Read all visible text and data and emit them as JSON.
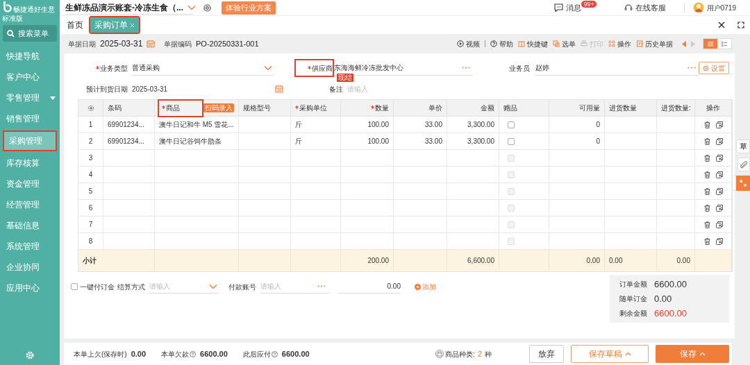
{
  "brand": {
    "name": "畅捷通好生意",
    "edition": "标准版"
  },
  "topbar": {
    "account": "生鲜冻品演示账套-冷冻生食（...",
    "promo_button": "体验行业方案",
    "messages": {
      "label": "消息",
      "badge": "99+"
    },
    "support": "在线客服",
    "user": "用户0719"
  },
  "sidebar": {
    "search": "搜索菜单",
    "items": [
      {
        "label": "快捷导航",
        "selected": false,
        "highlighted": false
      },
      {
        "label": "客户中心",
        "selected": false,
        "highlighted": false
      },
      {
        "label": "零售管理",
        "selected": false,
        "highlighted": false,
        "expanded": false
      },
      {
        "label": "销售管理",
        "selected": false,
        "highlighted": false
      },
      {
        "label": "采购管理",
        "selected": true,
        "highlighted": true
      },
      {
        "label": "库存核算",
        "selected": false,
        "highlighted": false
      },
      {
        "label": "资金管理",
        "selected": false,
        "highlighted": false
      },
      {
        "label": "经营管理",
        "selected": false,
        "highlighted": false
      },
      {
        "label": "基础信息",
        "selected": false,
        "highlighted": false
      },
      {
        "label": "系统管理",
        "selected": false,
        "highlighted": false
      },
      {
        "label": "企业协同",
        "selected": false,
        "highlighted": false
      },
      {
        "label": "应用中心",
        "selected": false,
        "highlighted": false
      }
    ]
  },
  "tabs": [
    {
      "label": "首页",
      "selected": false,
      "closable": false,
      "highlighted": false
    },
    {
      "label": "采购订单",
      "selected": true,
      "closable": true,
      "highlighted": true
    }
  ],
  "toolbar": {
    "date_label": "单据日期",
    "date": "2025-03-31",
    "code_label": "单据编码",
    "code": "PO-20250331-001",
    "actions": [
      {
        "kind": "video",
        "label": "视频",
        "disabled": false
      },
      {
        "kind": "help",
        "label": "帮助",
        "disabled": false
      },
      {
        "kind": "shortcut",
        "label": "快捷键",
        "disabled": false
      },
      {
        "kind": "select",
        "label": "选单",
        "disabled": false
      },
      {
        "kind": "print",
        "label": "打印",
        "disabled": true
      },
      {
        "kind": "operate",
        "label": "操作",
        "disabled": false
      },
      {
        "kind": "history",
        "label": "历史单据",
        "disabled": false
      }
    ],
    "views": [
      {
        "kind": "list",
        "selected": true
      },
      {
        "kind": "detail",
        "selected": false
      }
    ]
  },
  "form": {
    "business_type": {
      "label": "业务类型",
      "required": true,
      "value": "普通采购"
    },
    "supplier": {
      "label": "供应商",
      "required": true,
      "highlighted": true,
      "value": "东海海鲜冷冻批发中心",
      "tag": "现结"
    },
    "salesperson": {
      "label": "业务员",
      "value": "赵婷"
    },
    "settings_button": "设置",
    "arrival_date": {
      "label": "预计到货日期",
      "value": "2025-03-31"
    },
    "remark": {
      "label": "备注",
      "placeholder": "请输入"
    }
  },
  "table": {
    "columns": [
      {
        "label": "条码",
        "required": false
      },
      {
        "label": "商品",
        "required": true,
        "highlighted": true,
        "badge": "扫码录入"
      },
      {
        "label": "规格型号",
        "required": false
      },
      {
        "label": "采购单位",
        "required": true
      },
      {
        "label": "数量",
        "required": true
      },
      {
        "label": "单价",
        "required": false
      },
      {
        "label": "金额",
        "required": false
      },
      {
        "label": "赠品",
        "required": false
      },
      {
        "label": "可用量",
        "required": false
      },
      {
        "label": "进货数量",
        "required": false
      },
      {
        "label": "进货数量:",
        "required": false
      },
      {
        "label": "操作",
        "required": false
      }
    ],
    "rows": [
      {
        "index": "1",
        "barcode": "69901234...",
        "product": "澳牛日记和牛 M5 雪花...",
        "unit": "斤",
        "qty": "100.00",
        "price": "33.00",
        "amount": "3,300.00",
        "gift_checked": false,
        "gift_disabled": false,
        "available": "0"
      },
      {
        "index": "2",
        "barcode": "69901234...",
        "product": "澳牛日记谷饲牛肋条",
        "unit": "斤",
        "qty": "100.00",
        "price": "33.00",
        "amount": "3,300.00",
        "gift_checked": false,
        "gift_disabled": false,
        "available": "0"
      },
      {
        "index": "3",
        "gift_checked": false,
        "gift_disabled": true
      },
      {
        "index": "4",
        "gift_checked": false,
        "gift_disabled": true
      },
      {
        "index": "5",
        "gift_checked": false,
        "gift_disabled": true
      },
      {
        "index": "6",
        "gift_checked": false,
        "gift_disabled": true
      },
      {
        "index": "7",
        "gift_checked": false,
        "gift_disabled": true
      },
      {
        "index": "8",
        "gift_checked": false,
        "gift_disabled": true
      }
    ],
    "subtotal": {
      "label": "小计",
      "qty": "200.00",
      "amount": "6,600.00",
      "available": "0.00",
      "in_qty": "0.00",
      "in_qty_2": "0.00"
    }
  },
  "payment": {
    "deposit": {
      "label": "一键付订金",
      "checked": false
    },
    "method": {
      "label": "结算方式",
      "placeholder": "请输入"
    },
    "account": {
      "label": "付款账号",
      "placeholder": "请输入"
    },
    "amount": "0.00",
    "add": "添加"
  },
  "summary": [
    {
      "label": "订单金额",
      "value": "6600.00",
      "alert": false
    },
    {
      "label": "随单订金",
      "value": "0.00",
      "alert": false
    },
    {
      "label": "剩余金额",
      "value": "6600.00",
      "alert": true
    }
  ],
  "side_tools": {
    "draft": "草"
  },
  "footer": {
    "stats": [
      {
        "label": "本单上欠(保存时)",
        "value": "0.00",
        "help": false
      },
      {
        "label": "本单欠款",
        "value": "6600.00",
        "help": true
      },
      {
        "label": "此后应付",
        "value": "6600.00",
        "help": true
      }
    ],
    "kinds": {
      "label": "商品种类:",
      "count": "2",
      "unit": "种"
    },
    "buttons": [
      {
        "kind": "plain",
        "label": "放弃",
        "menu": false
      },
      {
        "kind": "outline",
        "label": "保存草稿",
        "menu": true
      },
      {
        "kind": "primary",
        "label": "保存",
        "menu": true
      }
    ]
  }
}
